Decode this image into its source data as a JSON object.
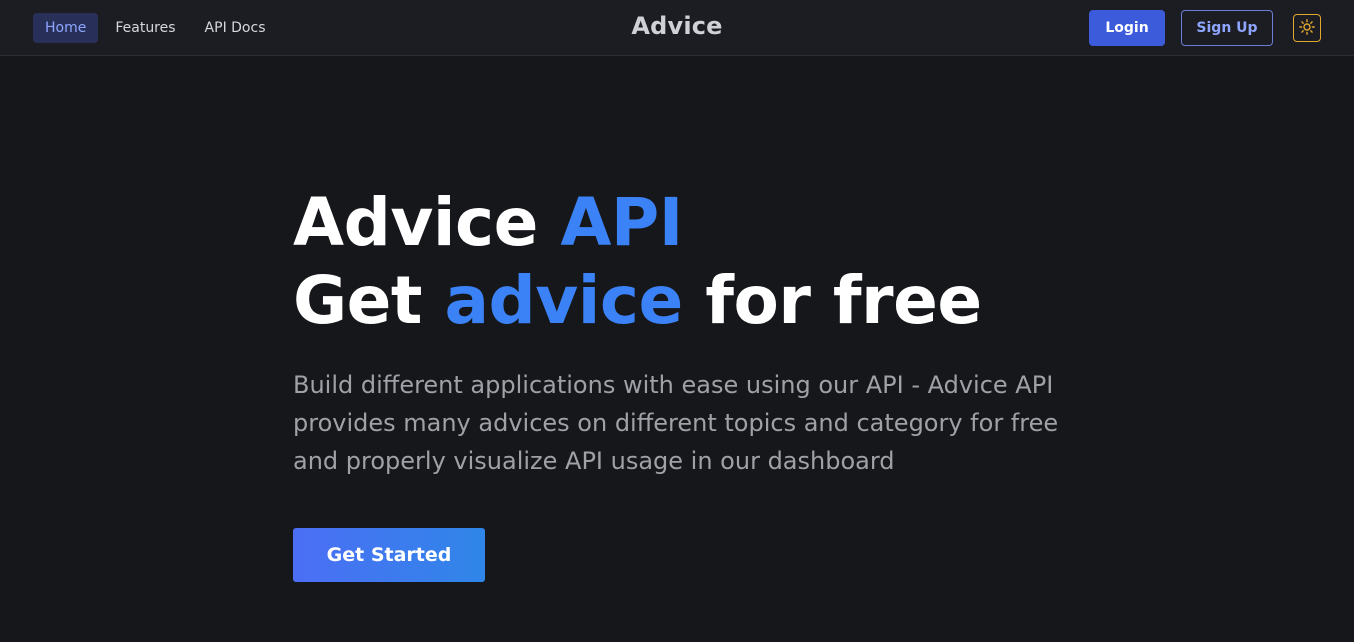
{
  "nav": {
    "links": [
      {
        "label": "Home",
        "active": true
      },
      {
        "label": "Features",
        "active": false
      },
      {
        "label": "API Docs",
        "active": false
      }
    ],
    "brand": "Advice",
    "login_label": "Login",
    "signup_label": "Sign Up",
    "theme_icon": "sun-icon"
  },
  "hero": {
    "line1_part1": "Advice ",
    "line1_accent": "API",
    "line2_part1": "Get ",
    "line2_accent": "advice",
    "line2_part2": " for free",
    "description": "Build different applications with ease using our API - Advice API provides many advices on different topics and category for free and properly visualize API usage in our dashboard",
    "cta_label": "Get Started"
  },
  "colors": {
    "background": "#16171b",
    "accent": "#3b82f6",
    "primary_button": "#3b5bdb",
    "theme_toggle": "#e0a82e"
  }
}
